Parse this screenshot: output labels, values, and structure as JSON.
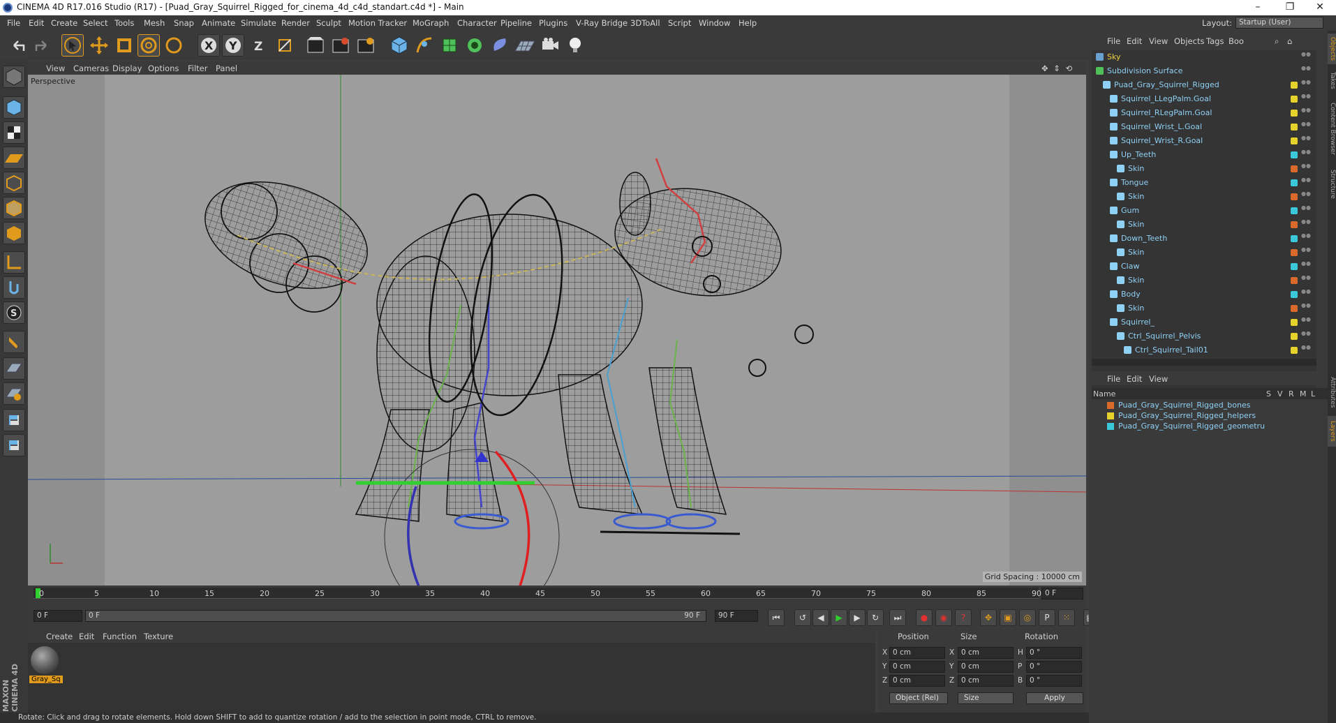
{
  "window": {
    "title": "CINEMA 4D R17.016 Studio (R17) - [Puad_Gray_Squirrel_Rigged_for_cinema_4d_c4d_standart.c4d *] - Main",
    "controls": [
      "–",
      "❐",
      "✕"
    ]
  },
  "menu": [
    "File",
    "Edit",
    "Create",
    "Select",
    "Tools",
    "Mesh",
    "Snap",
    "Animate",
    "Simulate",
    "Render",
    "Sculpt",
    "Motion Tracker",
    "MoGraph",
    "Character",
    "Pipeline",
    "Plugins",
    "V-Ray Bridge",
    "3DToAll",
    "Script",
    "Window",
    "Help"
  ],
  "layout": {
    "label": "Layout:",
    "value": "Startup (User)"
  },
  "toolbar": {
    "icons": [
      "undo-icon",
      "redo-icon",
      "select-arrow-icon",
      "move-icon",
      "scale-icon",
      "rotate-icon",
      "recent-tool-icon",
      "x-axis-lock-icon",
      "y-axis-lock-icon",
      "z-axis-lock-icon",
      "coordinate-system-icon",
      "render-view-icon",
      "render-picture-viewer-icon",
      "render-settings-icon",
      "cube-primitive-icon",
      "pen-spline-icon",
      "subdivision-icon",
      "array-icon",
      "deformer-icon",
      "floor-icon",
      "camera-icon",
      "light-icon"
    ],
    "axis_labels": [
      "X",
      "Y",
      "Z"
    ]
  },
  "left_tools": [
    "make-editable-icon",
    "model-mode-icon",
    "texture-mode-icon",
    "workplane-icon",
    "points-mode-icon",
    "edges-mode-icon",
    "polygons-mode-icon",
    "axis-mode-icon",
    "tweak-icon",
    "snap-s-icon",
    "magnet-icon",
    "solo-icon",
    "sculpt-icon",
    "python-icon",
    "python2-icon"
  ],
  "viewport": {
    "menu": [
      "View",
      "Cameras",
      "Display",
      "Options",
      "Filter",
      "Panel"
    ],
    "camera": "Perspective",
    "grid_spacing": "Grid Spacing : 10000 cm"
  },
  "timeline": {
    "ticks": [
      "0",
      "5",
      "10",
      "15",
      "20",
      "25",
      "30",
      "35",
      "40",
      "45",
      "50",
      "55",
      "60",
      "65",
      "70",
      "75",
      "80",
      "85",
      "90"
    ],
    "current_frame": "0 F",
    "start": "0 F",
    "range_start": "0 F",
    "range_end": "90 F",
    "end": "90 F"
  },
  "material_panel": {
    "menu": [
      "Create",
      "Edit",
      "Function",
      "Texture"
    ],
    "materials": [
      {
        "label": "Gray_Sq"
      }
    ]
  },
  "coordinates": {
    "headers": [
      "Position",
      "Size",
      "Rotation"
    ],
    "rows": [
      {
        "axis": "X",
        "pos": "0 cm",
        "saxis": "X",
        "size": "0 cm",
        "raxis": "H",
        "rot": "0 °"
      },
      {
        "axis": "Y",
        "pos": "0 cm",
        "saxis": "Y",
        "size": "0 cm",
        "raxis": "P",
        "rot": "0 °"
      },
      {
        "axis": "Z",
        "pos": "0 cm",
        "saxis": "Z",
        "size": "0 cm",
        "raxis": "B",
        "rot": "0 °"
      }
    ],
    "mode": "Object (Rel)",
    "size_mode": "Size",
    "apply": "Apply"
  },
  "status": "Rotate: Click and drag to rotate elements. Hold down SHIFT to add to quantize rotation / add to the selection in point mode, CTRL to remove.",
  "brand": "MAXON CINEMA 4D",
  "object_manager": {
    "menu": [
      "File",
      "Edit",
      "View",
      "Objects",
      "Tags",
      "Boo"
    ],
    "objects": [
      {
        "name": "Sky",
        "indent": 0,
        "icon": "#6aa0d0",
        "tag": ""
      },
      {
        "name": "Subdivision Surface",
        "indent": 0,
        "icon": "#4fc05a",
        "tag": ""
      },
      {
        "name": "Puad_Gray_Squirrel_Rigged",
        "indent": 1,
        "icon": "#8fd0f5",
        "tag": "#e6d22a"
      },
      {
        "name": "Squirrel_LLegPalm.Goal",
        "indent": 2,
        "icon": "#8fd0f5",
        "tag": "#e6d22a"
      },
      {
        "name": "Squirrel_RLegPalm.Goal",
        "indent": 2,
        "icon": "#8fd0f5",
        "tag": "#e6d22a"
      },
      {
        "name": "Squirrel_Wrist_L.Goal",
        "indent": 2,
        "icon": "#8fd0f5",
        "tag": "#e6d22a"
      },
      {
        "name": "Squirrel_Wrist_R.Goal",
        "indent": 2,
        "icon": "#8fd0f5",
        "tag": "#e6d22a"
      },
      {
        "name": "Up_Teeth",
        "indent": 2,
        "icon": "#8fd0f5",
        "tag": "#3bc9d9"
      },
      {
        "name": "Skin",
        "indent": 3,
        "icon": "#8fd0f5",
        "tag": "#d86a2a"
      },
      {
        "name": "Tongue",
        "indent": 2,
        "icon": "#8fd0f5",
        "tag": "#3bc9d9"
      },
      {
        "name": "Skin",
        "indent": 3,
        "icon": "#8fd0f5",
        "tag": "#d86a2a"
      },
      {
        "name": "Gum",
        "indent": 2,
        "icon": "#8fd0f5",
        "tag": "#3bc9d9"
      },
      {
        "name": "Skin",
        "indent": 3,
        "icon": "#8fd0f5",
        "tag": "#d86a2a"
      },
      {
        "name": "Down_Teeth",
        "indent": 2,
        "icon": "#8fd0f5",
        "tag": "#3bc9d9"
      },
      {
        "name": "Skin",
        "indent": 3,
        "icon": "#8fd0f5",
        "tag": "#d86a2a"
      },
      {
        "name": "Claw",
        "indent": 2,
        "icon": "#8fd0f5",
        "tag": "#3bc9d9"
      },
      {
        "name": "Skin",
        "indent": 3,
        "icon": "#8fd0f5",
        "tag": "#d86a2a"
      },
      {
        "name": "Body",
        "indent": 2,
        "icon": "#8fd0f5",
        "tag": "#3bc9d9"
      },
      {
        "name": "Skin",
        "indent": 3,
        "icon": "#8fd0f5",
        "tag": "#d86a2a"
      },
      {
        "name": "Squirrel_",
        "indent": 2,
        "icon": "#8fd0f5",
        "tag": "#e6d22a"
      },
      {
        "name": "Ctrl_Squirrel_Pelvis",
        "indent": 3,
        "icon": "#8fd0f5",
        "tag": "#e6d22a"
      },
      {
        "name": "Ctrl_Squirrel_Tail01",
        "indent": 4,
        "icon": "#8fd0f5",
        "tag": "#e6d22a"
      }
    ]
  },
  "layer_manager": {
    "menu": [
      "File",
      "Edit",
      "View"
    ],
    "columns": [
      "Name",
      "S",
      "V",
      "R",
      "M",
      "L"
    ],
    "layers": [
      {
        "name": "Puad_Gray_Squirrel_Rigged_bones",
        "color": "#d86a2a"
      },
      {
        "name": "Puad_Gray_Squirrel_Rigged_helpers",
        "color": "#e6d22a"
      },
      {
        "name": "Puad_Gray_Squirrel_Rigged_geometru",
        "color": "#3bc9d9"
      }
    ]
  },
  "side_tabs": [
    "Objects",
    "Takes",
    "Content Browser",
    "Structure",
    "Attributes",
    "Layers"
  ]
}
